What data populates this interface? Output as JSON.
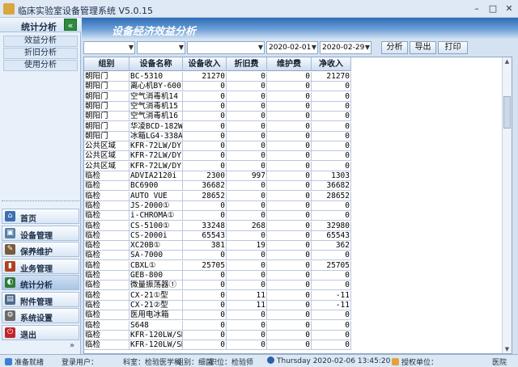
{
  "window": {
    "title": "临床实验室设备管理系统 V5.0.15",
    "min_symbol": "–",
    "max_symbol": "□",
    "close_symbol": "✕"
  },
  "sidebar": {
    "title": "统计分析",
    "collapse_symbol": "«",
    "subitems": [
      "效益分析",
      "折旧分析",
      "使用分析"
    ],
    "nav": [
      {
        "label": "首页",
        "icon": "home-icon",
        "color": "#3b6fb0",
        "glyph": "⌂"
      },
      {
        "label": "设备管理",
        "icon": "device-icon",
        "color": "#5a7fa8",
        "glyph": "▣"
      },
      {
        "label": "保养维护",
        "icon": "wrench-icon",
        "color": "#7a5a3a",
        "glyph": "✎"
      },
      {
        "label": "业务管理",
        "icon": "bar-chart-icon",
        "color": "#b04020",
        "glyph": "▮"
      },
      {
        "label": "统计分析",
        "icon": "chart-icon",
        "color": "#2f7a3a",
        "glyph": "◐"
      },
      {
        "label": "附件管理",
        "icon": "attachment-icon",
        "color": "#4f6a8a",
        "glyph": "▤"
      },
      {
        "label": "系统设置",
        "icon": "settings-icon",
        "color": "#6a6a6a",
        "glyph": "⚙"
      },
      {
        "label": "退出",
        "icon": "exit-icon",
        "color": "#c0262b",
        "glyph": "⏻"
      }
    ],
    "more_symbol": "»"
  },
  "main": {
    "title": "设备经济效益分析",
    "filters": {
      "combo1": "",
      "combo2": "",
      "combo3": "",
      "date_from": "2020-02-01",
      "date_to": "2020-02-29"
    },
    "buttons": [
      "分析",
      "导出",
      "打印"
    ]
  },
  "table": {
    "columns": [
      "组别",
      "设备名称",
      "设备收入",
      "折旧费",
      "维护费",
      "净收入"
    ],
    "rows": [
      [
        "朝阳门",
        "BC-5310",
        "21270",
        "0",
        "0",
        "21270"
      ],
      [
        "朝阳门",
        "离心机BY-600",
        "0",
        "0",
        "0",
        "0"
      ],
      [
        "朝阳门",
        "空气消毒机14",
        "0",
        "0",
        "0",
        "0"
      ],
      [
        "朝阳门",
        "空气消毒机15",
        "0",
        "0",
        "0",
        "0"
      ],
      [
        "朝阳门",
        "空气消毒机16",
        "0",
        "0",
        "0",
        "0"
      ],
      [
        "朝阳门",
        "华凌BCD-182W",
        "0",
        "0",
        "0",
        "0"
      ],
      [
        "朝阳门",
        "冰箱LG4-338A",
        "0",
        "0",
        "0",
        "0"
      ],
      [
        "公共区域",
        "KFR-72LW/DY-",
        "0",
        "0",
        "0",
        "0"
      ],
      [
        "公共区域",
        "KFR-72LW/DY-",
        "0",
        "0",
        "0",
        "0"
      ],
      [
        "公共区域",
        "KFR-72LW/DY-",
        "0",
        "0",
        "0",
        "0"
      ],
      [
        "临检",
        "ADVIA2120i",
        "2300",
        "997",
        "0",
        "1303"
      ],
      [
        "临检",
        "BC6900",
        "36682",
        "0",
        "0",
        "36682"
      ],
      [
        "临检",
        "AUTO VUE",
        "28652",
        "0",
        "0",
        "28652"
      ],
      [
        "临检",
        "JS-2000①",
        "0",
        "0",
        "0",
        "0"
      ],
      [
        "临检",
        "i-CHROMA①",
        "0",
        "0",
        "0",
        "0"
      ],
      [
        "临检",
        "CS-5100①",
        "33248",
        "268",
        "0",
        "32980"
      ],
      [
        "临检",
        "CS-2000i",
        "65543",
        "0",
        "0",
        "65543"
      ],
      [
        "临检",
        "XC20B①",
        "381",
        "19",
        "0",
        "362"
      ],
      [
        "临检",
        "SA-7000",
        "0",
        "0",
        "0",
        "0"
      ],
      [
        "临检",
        "CBXL①",
        "25705",
        "0",
        "0",
        "25705"
      ],
      [
        "临检",
        "GEB-800",
        "0",
        "0",
        "0",
        "0"
      ],
      [
        "临检",
        "微量振荡器①",
        "0",
        "0",
        "0",
        "0"
      ],
      [
        "临检",
        "CX-21①型",
        "0",
        "11",
        "0",
        "-11"
      ],
      [
        "临检",
        "CX-21②型",
        "0",
        "11",
        "0",
        "-11"
      ],
      [
        "临检",
        "医用电冰箱",
        "0",
        "0",
        "0",
        "0"
      ],
      [
        "临检",
        "S648",
        "0",
        "0",
        "0",
        "0"
      ],
      [
        "临检",
        "KFR-120LW/SD",
        "0",
        "0",
        "0",
        "0"
      ],
      [
        "临检",
        "KFR-120LW/SD",
        "0",
        "0",
        "0",
        "0"
      ]
    ]
  },
  "statusbar": {
    "ready": "准备就绪",
    "user": "登录用户：",
    "dept": "科室：检验医学科",
    "group": "组别：细菌",
    "title": "职位：检验师",
    "datetime": "Thursday 2020-02-06 13:45:20",
    "auth": "授权单位：",
    "org": "医院"
  }
}
